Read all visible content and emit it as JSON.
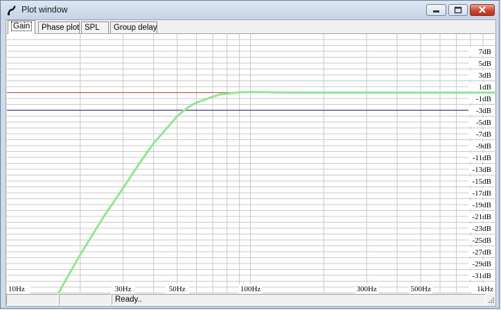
{
  "window": {
    "title": "Plot window"
  },
  "tabs": [
    {
      "label": "Gain",
      "active": true
    },
    {
      "label": "Phase plot",
      "active": false
    },
    {
      "label": "SPL",
      "active": false
    },
    {
      "label": "Group delay",
      "active": false
    }
  ],
  "status": {
    "cell1": "",
    "cell2": "",
    "message": "Ready.."
  },
  "colors": {
    "curve": "#8fe88f",
    "ref_zero": "#c45a5a",
    "ref_minus3": "#3a3a7a",
    "grid": "#c8c8c8"
  },
  "chart_data": {
    "type": "line",
    "x_scale": "log",
    "xlim": [
      10,
      1000
    ],
    "x_tick_labels": [
      {
        "value": 10,
        "label": "10Hz"
      },
      {
        "value": 30,
        "label": "30Hz"
      },
      {
        "value": 50,
        "label": "50Hz"
      },
      {
        "value": 100,
        "label": "100Hz"
      },
      {
        "value": 300,
        "label": "300Hz"
      },
      {
        "value": 500,
        "label": "500Hz"
      },
      {
        "value": 1000,
        "label": "1kHz"
      }
    ],
    "ylim": [
      -35,
      9
    ],
    "y_tick_labels": [
      {
        "value": 7,
        "label": "7dB"
      },
      {
        "value": 5,
        "label": "5dB"
      },
      {
        "value": 3,
        "label": "3dB"
      },
      {
        "value": 1,
        "label": "1dB"
      },
      {
        "value": -1,
        "label": "-1dB"
      },
      {
        "value": -3,
        "label": "-3dB"
      },
      {
        "value": -5,
        "label": "-5dB"
      },
      {
        "value": -7,
        "label": "-7dB"
      },
      {
        "value": -9,
        "label": "-9dB"
      },
      {
        "value": -11,
        "label": "-11dB"
      },
      {
        "value": -13,
        "label": "-13dB"
      },
      {
        "value": -15,
        "label": "-15dB"
      },
      {
        "value": -17,
        "label": "-17dB"
      },
      {
        "value": -19,
        "label": "-19dB"
      },
      {
        "value": -21,
        "label": "-21dB"
      },
      {
        "value": -23,
        "label": "-23dB"
      },
      {
        "value": -25,
        "label": "-25dB"
      },
      {
        "value": -27,
        "label": "-27dB"
      },
      {
        "value": -29,
        "label": "-29dB"
      },
      {
        "value": -31,
        "label": "-31dB"
      },
      {
        "value": -33,
        "label": "-33dB"
      }
    ],
    "reference_lines": [
      {
        "value": 0,
        "color": "#c45a5a"
      },
      {
        "value": -3,
        "color": "#3a3a7a"
      }
    ],
    "grid": true,
    "series": [
      {
        "x": [
          15.5,
          20,
          25,
          30,
          35,
          40,
          45,
          50,
          55,
          60,
          65,
          70,
          75,
          80,
          90,
          100,
          110,
          120,
          150,
          200,
          300,
          500,
          1000
        ],
        "y": [
          -35.5,
          -27.5,
          -21,
          -16.2,
          -12,
          -8.6,
          -6.2,
          -4.0,
          -2.6,
          -1.7,
          -1.2,
          -0.7,
          -0.3,
          -0.2,
          0.05,
          0.1,
          0.08,
          0.05,
          0.0,
          0.0,
          0.0,
          0.0,
          0.0
        ]
      }
    ]
  }
}
